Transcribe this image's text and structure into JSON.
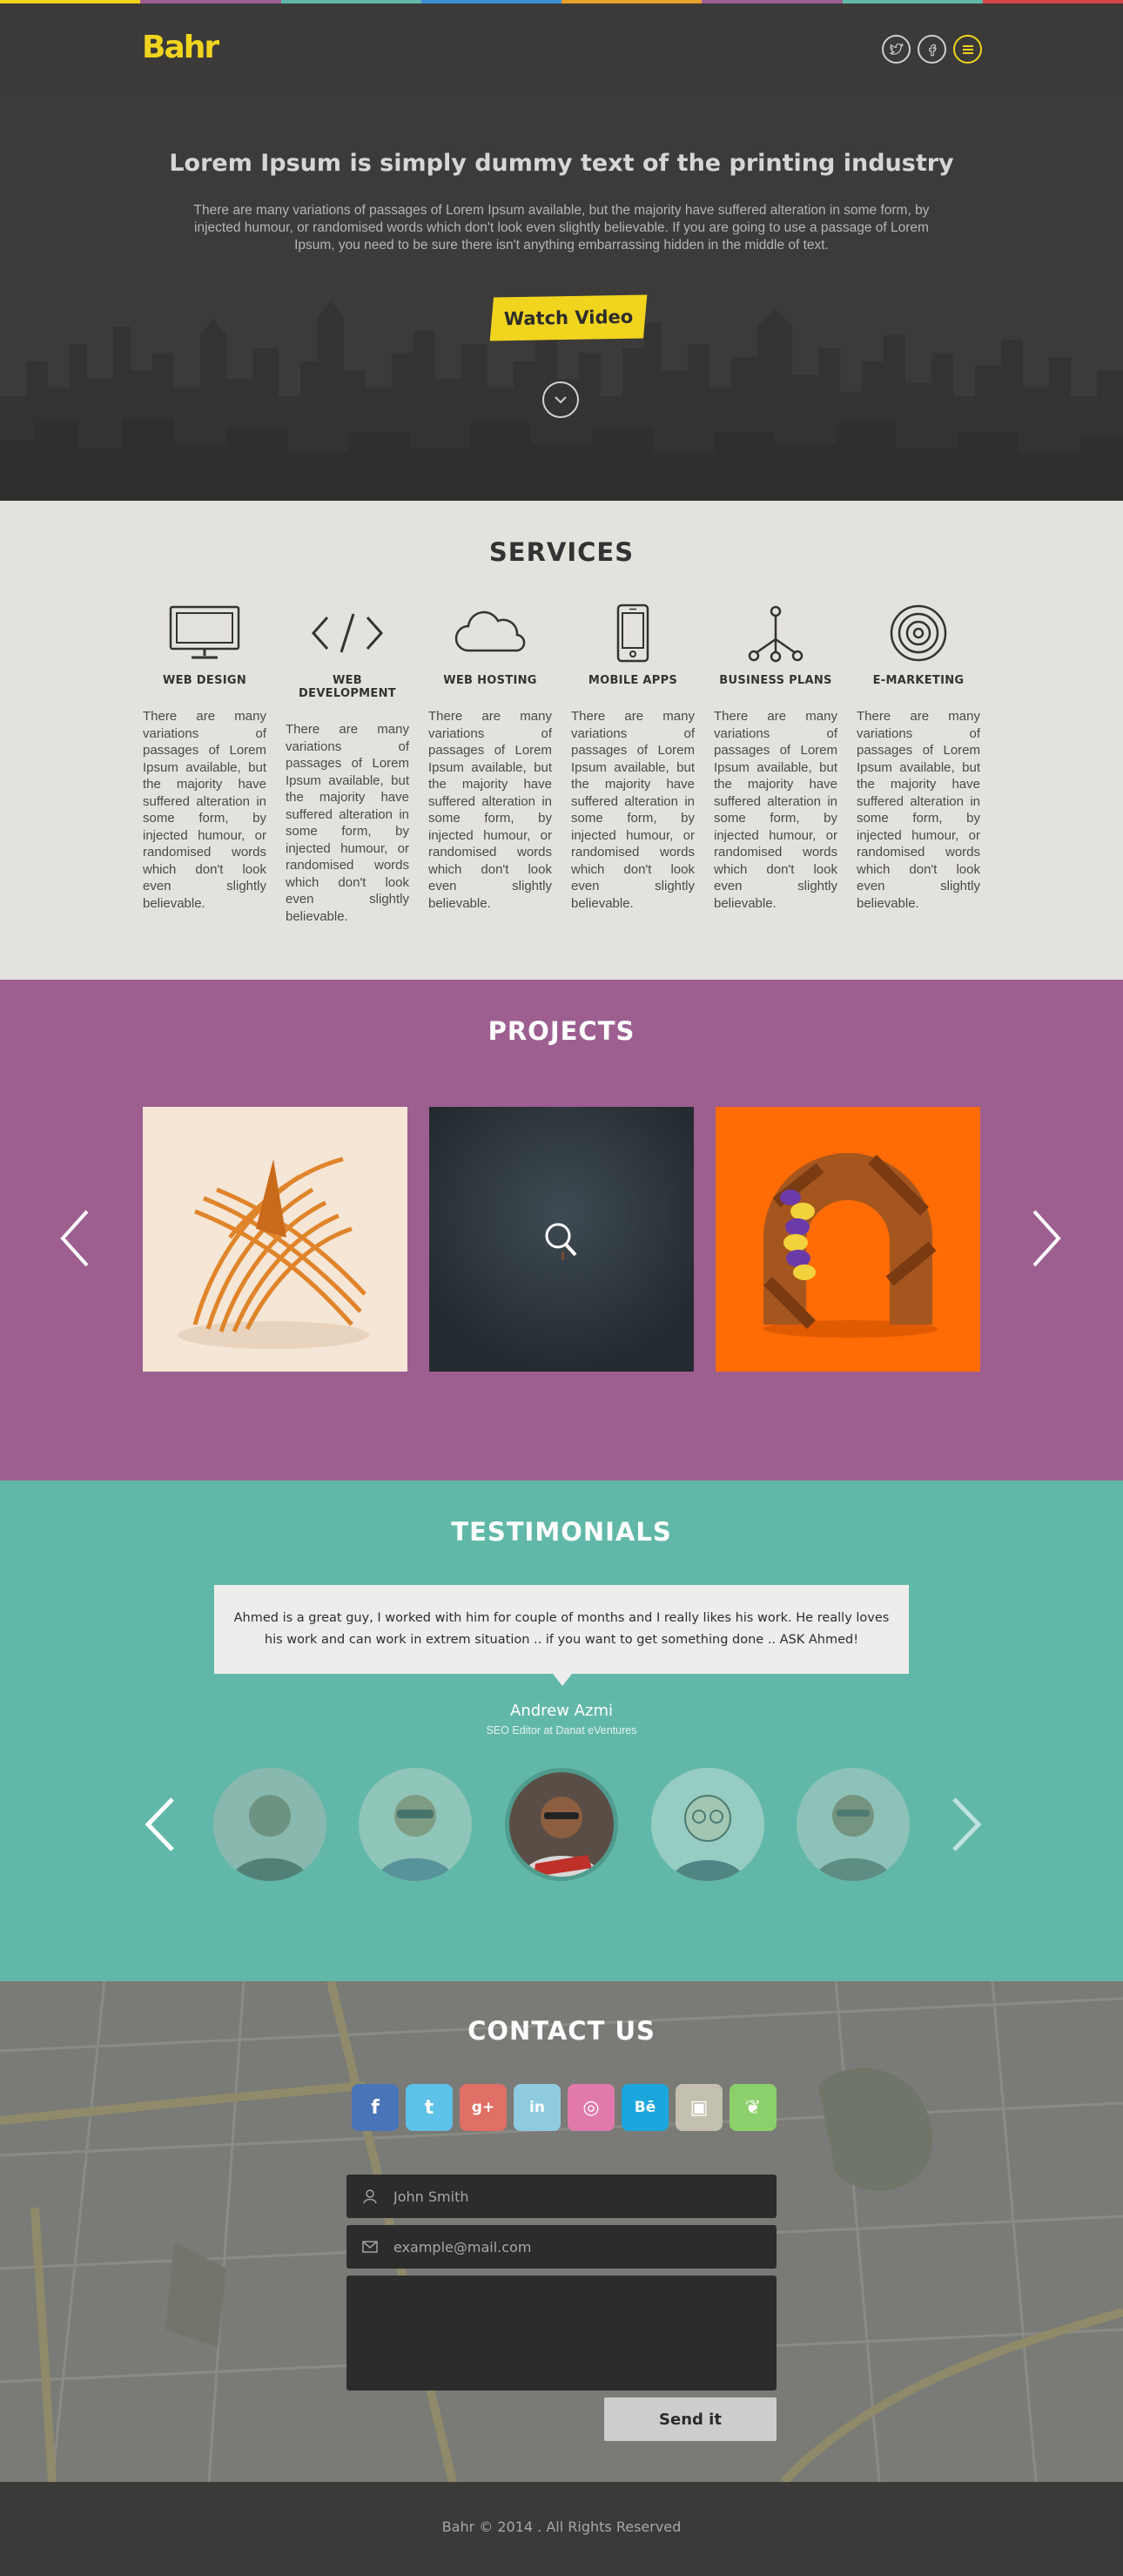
{
  "brand": {
    "logo": "Bahr",
    "accent_color": "#f1d41e",
    "strip_colors": [
      "#f1d41e",
      "#9d5f90",
      "#62b8a8",
      "#3a8fd4",
      "#e8a22c",
      "#9d5f90",
      "#62b8a8",
      "#d64545"
    ]
  },
  "header": {
    "icons": [
      "twitter-icon",
      "facebook-icon",
      "menu-icon"
    ]
  },
  "hero": {
    "title": "Lorem Ipsum is simply dummy text of the printing industry",
    "text": "There are many variations of passages of Lorem Ipsum available, but the majority have suffered alteration in some form, by injected humour, or randomised words which don't look even slightly believable. If you are going to use a passage of Lorem Ipsum, you need to be sure there isn't anything embarrassing hidden in the middle of text.",
    "button_label": "Watch Video"
  },
  "services": {
    "title": "SERVICES",
    "items": [
      {
        "name": "WEB DESIGN",
        "icon": "monitor-icon",
        "text": "There are many variations of passages of Lorem Ipsum available, but the majority have suffered alteration in some form, by injected humour, or randomised words which don't look even slightly believable."
      },
      {
        "name": "WEB DEVELOPMENT",
        "icon": "code-icon",
        "text": "There are many variations of passages of Lorem Ipsum available, but the majority have suffered alteration in some form, by injected humour, or randomised words which don't look even slightly believable."
      },
      {
        "name": "WEB HOSTING",
        "icon": "cloud-icon",
        "text": "There are many variations of passages of Lorem Ipsum available, but the majority have suffered alteration in some form, by injected humour, or randomised words which don't look even slightly believable."
      },
      {
        "name": "MOBILE APPS",
        "icon": "smartphone-icon",
        "text": "There are many variations of passages of Lorem Ipsum available, but the majority have suffered alteration in some form, by injected humour, or randomised words which don't look even slightly believable."
      },
      {
        "name": "BUSINESS PLANS",
        "icon": "network-icon",
        "text": "There are many variations of passages of Lorem Ipsum available, but the majority have suffered alteration in some form, by injected humour, or randomised words which don't look even slightly believable."
      },
      {
        "name": "E-MARKETING",
        "icon": "target-icon",
        "text": "There are many variations of passages of Lorem Ipsum available, but the majority have suffered alteration in some form, by injected humour, or randomised words which don't look even slightly believable."
      }
    ]
  },
  "projects": {
    "title": "PROJECTS",
    "bg_color": "#9d5f90",
    "items": [
      "orange-sculpture-image",
      "dark-project-image",
      "orange-arch-image"
    ]
  },
  "testimonials": {
    "title": "TESTIMONIALS",
    "bg_color": "#62b8a8",
    "quote": "Ahmed is a great guy, I worked with him for couple of months and I really likes his work. He really loves his work and can work in extrem situation .. if you want to get something done .. ASK Ahmed!",
    "name": "Andrew Azmi",
    "role": "SEO Editor at Danat eVentures",
    "active_avatar": 2,
    "avatar_count": 5
  },
  "contact": {
    "title": "CONTACT US",
    "social": [
      {
        "name": "facebook-icon",
        "glyph": "f",
        "color": "#4a74b8"
      },
      {
        "name": "twitter-icon",
        "glyph": "t",
        "color": "#5ec1e8"
      },
      {
        "name": "google-plus-icon",
        "glyph": "g+",
        "color": "#e06f66"
      },
      {
        "name": "linkedin-icon",
        "glyph": "in",
        "color": "#8fcbe0"
      },
      {
        "name": "dribbble-icon",
        "glyph": "◎",
        "color": "#e17aab"
      },
      {
        "name": "behance-icon",
        "glyph": "Bē",
        "color": "#1ba6de"
      },
      {
        "name": "instagram-icon",
        "glyph": "▣",
        "color": "#c4c0b0"
      },
      {
        "name": "evernote-icon",
        "glyph": "❦",
        "color": "#8bd06a"
      }
    ],
    "name_placeholder": "John Smith",
    "email_placeholder": "example@mail.com",
    "send_label": "Send it"
  },
  "footer": {
    "copyright": "Bahr © 2014 . All Rights Reserved"
  }
}
